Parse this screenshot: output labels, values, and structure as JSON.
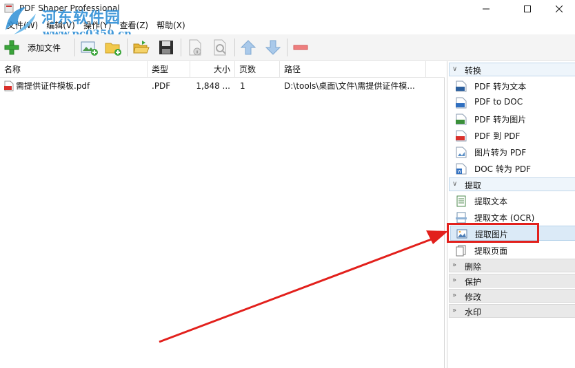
{
  "window": {
    "title": "PDF Shaper Professional"
  },
  "watermark": {
    "site_name": "河东软件园",
    "url": "www.pc0359.cn"
  },
  "menu": [
    "文件(W)",
    "编辑(V)",
    "操作(Y)",
    "查看(Z)",
    "帮助(X)"
  ],
  "toolbar": {
    "add_label": "添加文件",
    "icons": [
      "add-icon",
      "add-image-icon",
      "add-folder-icon",
      "open-folder-icon",
      "save-icon",
      "info-icon",
      "preview-icon",
      "move-up-icon",
      "move-down-icon",
      "remove-icon"
    ]
  },
  "filelist": {
    "columns": [
      "名称",
      "类型",
      "大小",
      "页数",
      "路径"
    ],
    "rows": [
      {
        "name": "需提供证件模板.pdf",
        "type": ".PDF",
        "size": "1,848 ...",
        "pages": "1",
        "path": "D:\\tools\\桌面\\文件\\需提供证件模..."
      }
    ]
  },
  "panel": {
    "groups": [
      {
        "label": "转换",
        "open": true,
        "items": [
          "PDF 转为文本",
          "PDF to DOC",
          "PDF 转为图片",
          "PDF 到 PDF",
          "图片转为 PDF",
          "DOC 转为 PDF"
        ]
      },
      {
        "label": "提取",
        "open": true,
        "items": [
          "提取文本",
          "提取文本 (OCR)",
          "提取图片",
          "提取页面"
        ]
      },
      {
        "label": "删除",
        "open": false,
        "items": []
      },
      {
        "label": "保护",
        "open": false,
        "items": []
      },
      {
        "label": "修改",
        "open": false,
        "items": []
      },
      {
        "label": "水印",
        "open": false,
        "items": []
      }
    ],
    "selected_item": "提取图片"
  },
  "colors": {
    "annotation": "#e2201c",
    "watermark": "#2e8fd6",
    "accent_green": "#3aa53a",
    "accent_blue": "#3b7fc4"
  }
}
